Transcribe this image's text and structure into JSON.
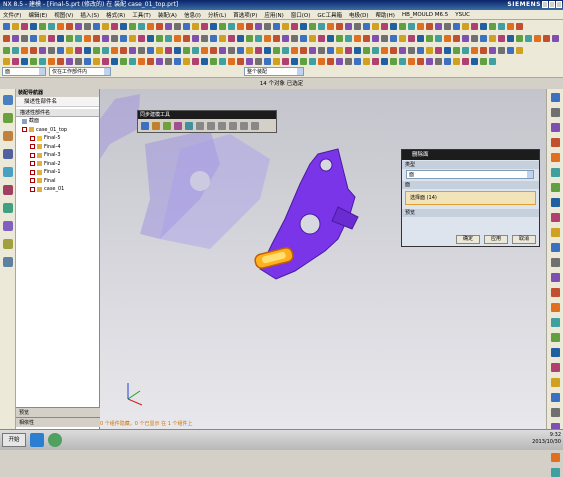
{
  "window": {
    "title": "NX 8.5 - 建模 - [Final-5.prt (修改的) 在 装配 case_01_top.prt]",
    "brand": "SIEMENS"
  },
  "menu": [
    "文件(F)",
    "编辑(E)",
    "视图(V)",
    "插入(S)",
    "格式(R)",
    "工具(T)",
    "装配(A)",
    "信息(I)",
    "分析(L)",
    "首选项(P)",
    "应用(N)",
    "窗口(O)",
    "GC工具箱",
    "电极(D)",
    "帮助(H)",
    "HB_MOULD M6.5",
    "YSUC"
  ],
  "selection": {
    "filter": "面",
    "scope": "仅在工作部件内",
    "mode": "整个装配"
  },
  "status_message": "14 个对象 已选定",
  "navigator": {
    "title": "装配导航器",
    "subtitle": "描述性部件名",
    "column_header": "描述性部件名",
    "items": [
      "截面",
      "case_01_top",
      "Final-5",
      "Final-4",
      "Final-3",
      "Final-2",
      "Final-1",
      "Final",
      "case_01"
    ],
    "footer1": "预览",
    "footer2": "相依性"
  },
  "floating_toolbar": {
    "title": "同步建模工具"
  },
  "dialog": {
    "title": "删除面",
    "section_type": "类型",
    "type_value": "面",
    "section_face": "面",
    "face_value": "选择面 (14)",
    "section_preview": "预览",
    "ok": "确定",
    "apply": "应用",
    "cancel": "取消"
  },
  "info_line": "0 个组件隐藏，0 个已显示 在 1 个组件上",
  "taskbar": {
    "start": "开始",
    "time": "9:32",
    "date": "2013/10/30"
  }
}
